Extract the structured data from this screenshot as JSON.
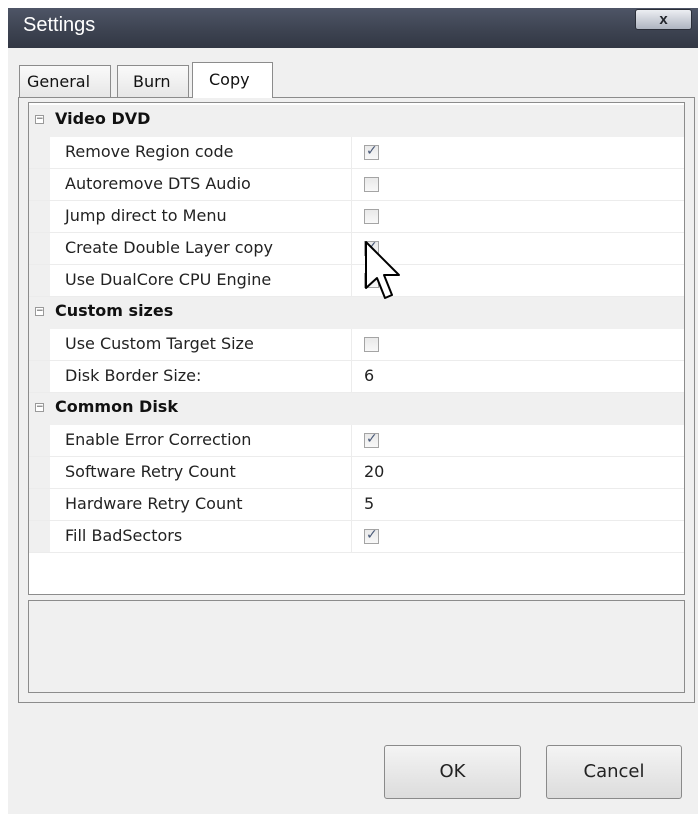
{
  "window": {
    "title": "Settings",
    "close_label": "x"
  },
  "tabs": [
    {
      "label": "General",
      "active": false
    },
    {
      "label": "Burn",
      "active": false
    },
    {
      "label": "Copy",
      "active": true
    }
  ],
  "categories": [
    {
      "label": "Video DVD",
      "expander": "⊟",
      "rows": [
        {
          "label": "Remove Region code",
          "type": "checkbox",
          "checked": true
        },
        {
          "label": "Autoremove DTS Audio",
          "type": "checkbox",
          "checked": false
        },
        {
          "label": "Jump direct to Menu",
          "type": "checkbox",
          "checked": false
        },
        {
          "label": "Create Double Layer copy",
          "type": "checkbox",
          "checked": true
        },
        {
          "label": "Use DualCore CPU Engine",
          "type": "checkbox",
          "checked": false
        }
      ]
    },
    {
      "label": "Custom sizes",
      "expander": "⊟",
      "rows": [
        {
          "label": "Use Custom Target Size",
          "type": "checkbox",
          "checked": false
        },
        {
          "label": "Disk Border Size:",
          "type": "text",
          "value": "6"
        }
      ]
    },
    {
      "label": "Common Disk",
      "expander": "⊟",
      "rows": [
        {
          "label": "Enable Error Correction",
          "type": "checkbox",
          "checked": true
        },
        {
          "label": "Software Retry Count",
          "type": "text",
          "value": "20"
        },
        {
          "label": "Hardware Retry Count",
          "type": "text",
          "value": "5"
        },
        {
          "label": "Fill BadSectors",
          "type": "checkbox",
          "checked": true
        }
      ]
    }
  ],
  "buttons": {
    "ok_label": "OK",
    "cancel_label": "Cancel"
  },
  "colors": {
    "titlebar": "#3c4250",
    "check": "#4a5a78",
    "panel": "#f0f0f0"
  }
}
